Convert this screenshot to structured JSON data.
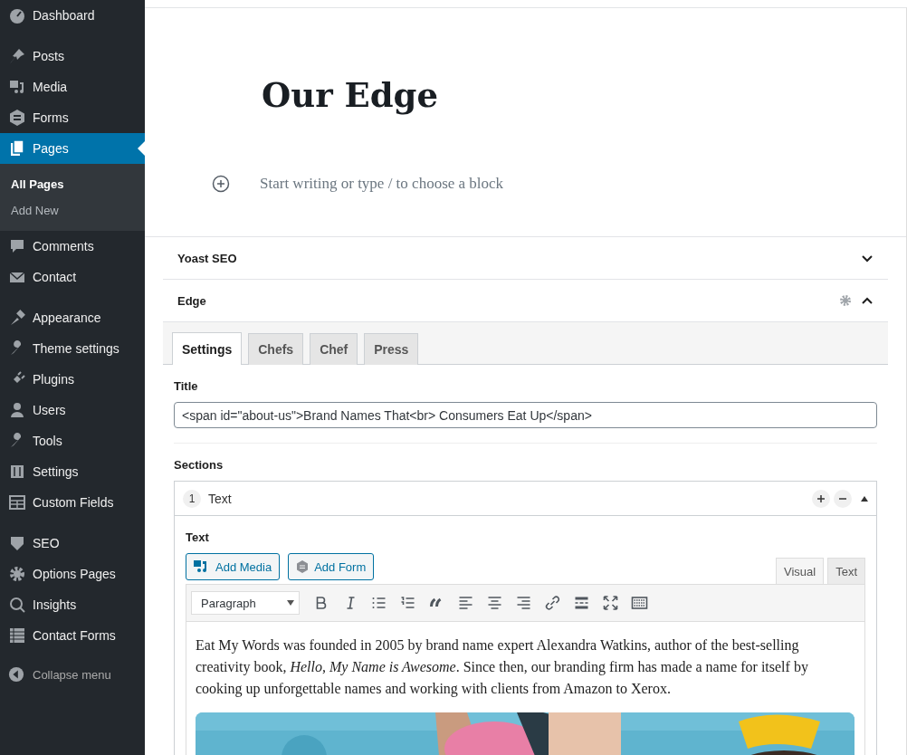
{
  "sidebar": {
    "groups": [
      {
        "items": [
          {
            "label": "Dashboard",
            "selected": false
          }
        ]
      },
      {
        "items": [
          {
            "label": "Posts",
            "selected": false
          },
          {
            "label": "Media",
            "selected": false
          },
          {
            "label": "Forms",
            "selected": false
          },
          {
            "label": "Pages",
            "selected": true,
            "children": [
              {
                "label": "All Pages",
                "selected": true
              },
              {
                "label": "Add New",
                "selected": false
              }
            ]
          },
          {
            "label": "Comments",
            "selected": false
          },
          {
            "label": "Contact",
            "selected": false
          }
        ]
      },
      {
        "items": [
          {
            "label": "Appearance",
            "selected": false
          },
          {
            "label": "Theme settings",
            "selected": false
          },
          {
            "label": "Plugins",
            "selected": false
          },
          {
            "label": "Users",
            "selected": false
          },
          {
            "label": "Tools",
            "selected": false
          },
          {
            "label": "Settings",
            "selected": false
          },
          {
            "label": "Custom Fields",
            "selected": false
          }
        ]
      },
      {
        "items": [
          {
            "label": "SEO",
            "selected": false
          },
          {
            "label": "Options Pages",
            "selected": false
          },
          {
            "label": "Insights",
            "selected": false
          },
          {
            "label": "Contact Forms",
            "selected": false
          }
        ]
      }
    ],
    "collapse": "Collapse menu"
  },
  "editor": {
    "title": "Our Edge",
    "placeholder": "Start writing or type / to choose a block"
  },
  "panels": [
    {
      "title": "Yoast SEO",
      "expanded": false
    },
    {
      "title": "Edge",
      "expanded": true
    }
  ],
  "edge": {
    "tabs": [
      {
        "label": "Settings",
        "selected": true
      },
      {
        "label": "Chefs",
        "selected": false
      },
      {
        "label": "Chef",
        "selected": false
      },
      {
        "label": "Press",
        "selected": false
      }
    ],
    "title_label": "Title",
    "title_value": "<span id=\"about-us\">Brand Names That<br> Consumers Eat Up</span>",
    "sections_label": "Sections",
    "section": {
      "number": "1",
      "name": "Text",
      "field_label": "Text",
      "buttons": [
        "Add Media",
        "Add Form"
      ],
      "editor_tabs": [
        {
          "label": "Visual",
          "selected": true
        },
        {
          "label": "Text",
          "selected": false
        }
      ],
      "format": "Paragraph",
      "content": "Eat My Words was founded in 2005 by brand name expert Alexandra Watkins, author of the best-selling creativity book, *Hello, My Name is Awesome*. Since then, our branding firm has made a name for itself by cooking up unforgettable names and working with clients from Amazon to Xerox."
    }
  }
}
